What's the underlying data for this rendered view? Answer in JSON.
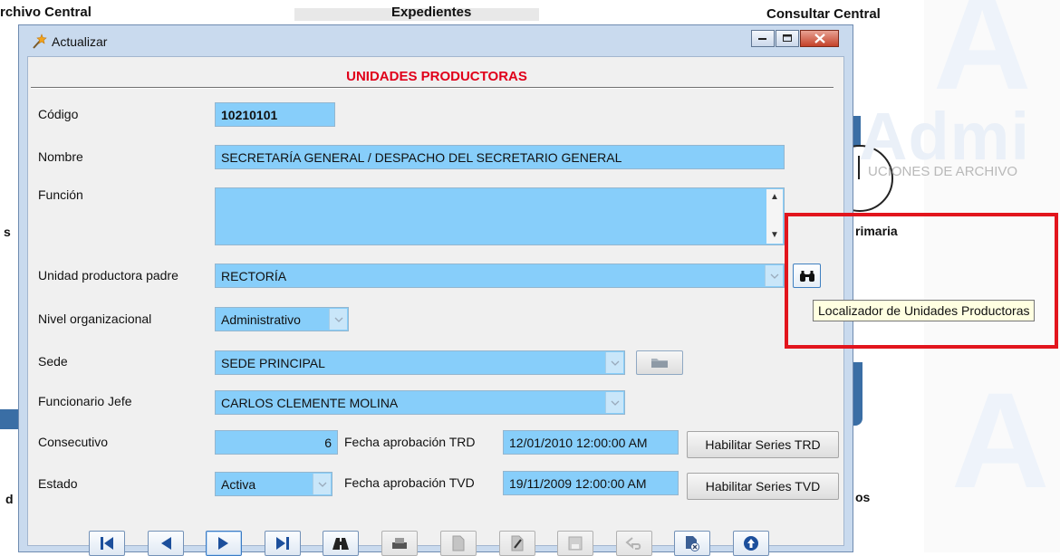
{
  "background": {
    "menu_left": "rchivo Central",
    "menu_center": "Expedientes",
    "menu_right": "Consultar Central",
    "right_label": "rimaria",
    "left_label_1": "s",
    "left_label_2": "d",
    "bottom_right_label": "os",
    "watermark_title": "Admi",
    "watermark_subtitle": "UCIONES DE ARCHIVO"
  },
  "window": {
    "title": "Actualizar",
    "icon": "wand-icon",
    "controls": [
      "minimize-icon",
      "maximize-icon",
      "close-icon"
    ]
  },
  "form": {
    "heading": "UNIDADES PRODUCTORAS",
    "codigo": {
      "label": "Código",
      "value": "10210101"
    },
    "nombre": {
      "label": "Nombre",
      "value": "SECRETARÍA GENERAL / DESPACHO DEL SECRETARIO GENERAL"
    },
    "funcion": {
      "label": "Función",
      "value": ""
    },
    "unidad_padre": {
      "label": "Unidad productora padre",
      "value": "RECTORÍA"
    },
    "nivel": {
      "label": "Nivel organizacional",
      "value": "Administrativo"
    },
    "sede": {
      "label": "Sede",
      "value": "SEDE PRINCIPAL"
    },
    "jefe": {
      "label": "Funcionario Jefe",
      "value": "CARLOS CLEMENTE MOLINA"
    },
    "consecutivo": {
      "label": "Consecutivo",
      "value": "6"
    },
    "fecha_trd": {
      "label": "Fecha aprobación TRD",
      "value": "12/01/2010 12:00:00 AM"
    },
    "habilitar_trd": "Habilitar Series TRD",
    "estado": {
      "label": "Estado",
      "value": "Activa"
    },
    "fecha_tvd": {
      "label": "Fecha aprobación TVD",
      "value": "19/11/2009 12:00:00 AM"
    },
    "habilitar_tvd": "Habilitar Series TVD"
  },
  "tooltip": "Localizador de Unidades Productoras",
  "toolbar": [
    {
      "icon": "first-record-icon",
      "enabled": true
    },
    {
      "icon": "previous-record-icon",
      "enabled": true
    },
    {
      "icon": "next-record-icon",
      "enabled": true,
      "focused": true
    },
    {
      "icon": "last-record-icon",
      "enabled": true
    },
    {
      "icon": "binoculars-search-icon",
      "enabled": true
    },
    {
      "icon": "print-icon",
      "enabled": false
    },
    {
      "icon": "new-document-icon",
      "enabled": false
    },
    {
      "icon": "edit-icon",
      "enabled": false
    },
    {
      "icon": "save-icon",
      "enabled": false
    },
    {
      "icon": "undo-icon",
      "enabled": false
    },
    {
      "icon": "delete-icon",
      "enabled": true
    },
    {
      "icon": "info-icon",
      "enabled": true
    }
  ],
  "colors": {
    "heading_red": "#e0001a",
    "field_blue": "#87cefa",
    "highlight_red": "#e2151d",
    "dialog_frame": "#c9daee"
  }
}
